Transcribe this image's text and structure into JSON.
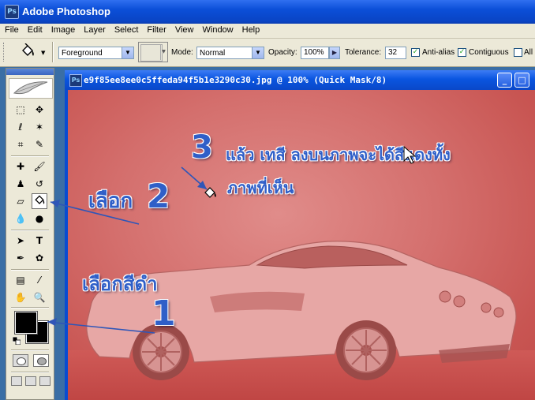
{
  "app": {
    "title": "Adobe Photoshop"
  },
  "menu": [
    "File",
    "Edit",
    "Image",
    "Layer",
    "Select",
    "Filter",
    "View",
    "Window",
    "Help"
  ],
  "options": {
    "fill_source": "Foreground",
    "mode_label": "Mode:",
    "mode_value": "Normal",
    "opacity_label": "Opacity:",
    "opacity_value": "100%",
    "tolerance_label": "Tolerance:",
    "tolerance_value": "32",
    "antialias_label": "Anti-alias",
    "antialias_checked": true,
    "contiguous_label": "Contiguous",
    "contiguous_checked": true,
    "all_layers_label": "All",
    "all_layers_checked": false
  },
  "document": {
    "title": "e9f85ee8ee0c5ffeda94f5b1e3290c30.jpg @ 100% (Quick Mask/8)",
    "overlay_color": "#d9615f"
  },
  "colors": {
    "foreground": "#000000",
    "background": "#000000"
  },
  "annotations": {
    "step1_text": "เลือกสีดำ",
    "step1_num": "1",
    "step2_text": "เลือก",
    "step2_num": "2",
    "step3_num": "3",
    "step3_line1": "แล้ว เทสี ลงบนภาพจะได้สีแดงทั้ง",
    "step3_line2": "ภาพที่เห็น"
  },
  "icons": {
    "paint_bucket": "paint-bucket-icon",
    "feather": "feather-icon",
    "cursor": "arrow-cursor-icon"
  }
}
